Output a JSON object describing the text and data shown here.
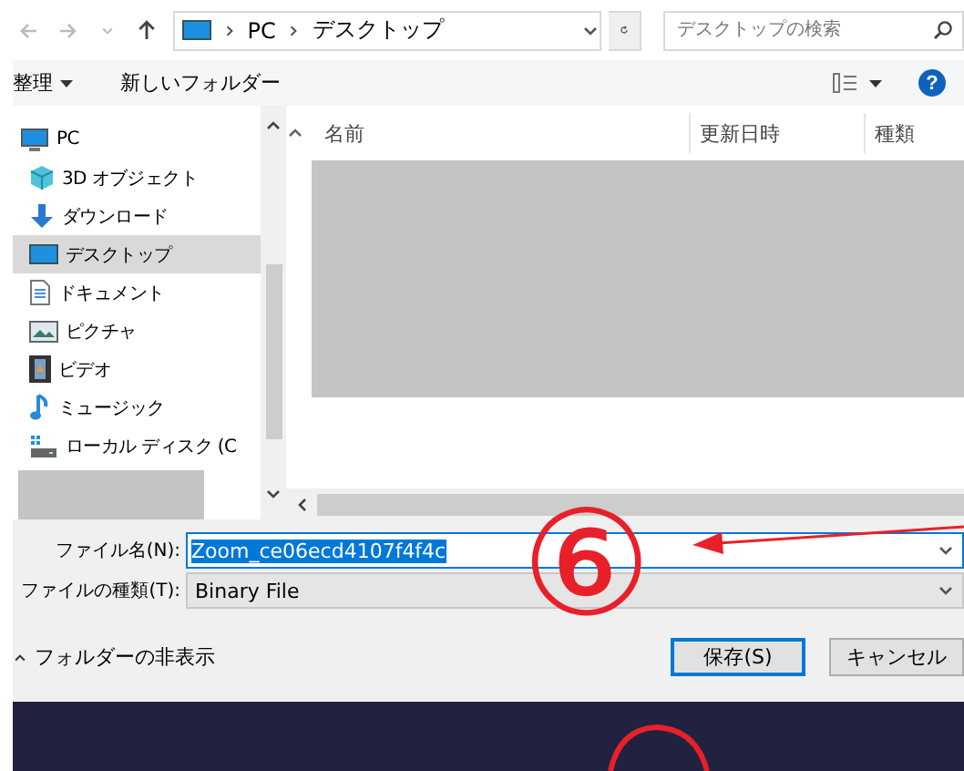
{
  "address_bar": {
    "breadcrumbs": [
      "PC",
      "デスクトップ"
    ]
  },
  "search": {
    "placeholder": "デスクトップの検索"
  },
  "toolbar": {
    "organize": "整理",
    "new_folder": "新しいフォルダー",
    "help": "?"
  },
  "sidebar": {
    "items": [
      {
        "label": "PC",
        "kind": "pc",
        "selected": false,
        "children": [
          {
            "label": "3D オブジェクト",
            "kind": "cube",
            "selected": false
          },
          {
            "label": "ダウンロード",
            "kind": "download",
            "selected": false
          },
          {
            "label": "デスクトップ",
            "kind": "desktop",
            "selected": true
          },
          {
            "label": "ドキュメント",
            "kind": "document",
            "selected": false
          },
          {
            "label": "ピクチャ",
            "kind": "picture",
            "selected": false
          },
          {
            "label": "ビデオ",
            "kind": "video",
            "selected": false
          },
          {
            "label": "ミュージック",
            "kind": "music",
            "selected": false
          },
          {
            "label": "ローカル ディスク (C",
            "kind": "disk",
            "selected": false
          }
        ]
      }
    ]
  },
  "file_list": {
    "columns": [
      "名前",
      "更新日時",
      "種類"
    ]
  },
  "form": {
    "filename_label": "ファイル名(N):",
    "filename_value": "Zoom_ce06ecd4107f4f4c",
    "filetype_label": "ファイルの種類(T):",
    "filetype_value": "Binary File"
  },
  "hide_folders": "フォルダーの非表示",
  "buttons": [
    {
      "label": "保存(S)",
      "default": true
    },
    {
      "label": "キャンセル",
      "default": false
    }
  ],
  "annotation": {
    "label": "⑥"
  }
}
